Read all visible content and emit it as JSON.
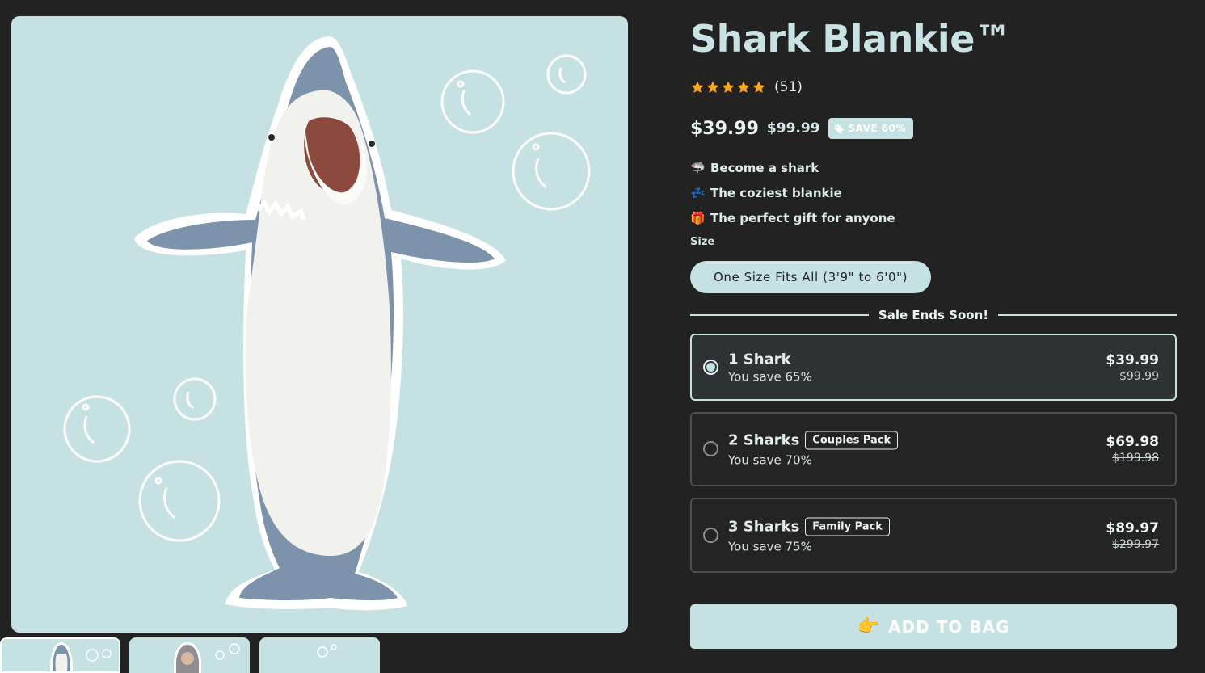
{
  "product": {
    "title": "Shark Blankie™",
    "review_count": "(51)",
    "rating_stars": 5,
    "price": "$39.99",
    "compare_price": "$99.99",
    "save_badge": "SAVE 60%"
  },
  "features": [
    {
      "icon": "shark-emoji-icon",
      "glyph": "🦈",
      "label": "Become a shark"
    },
    {
      "icon": "zzz-emoji-icon",
      "glyph": "💤",
      "label": "The coziest blankie"
    },
    {
      "icon": "gift-emoji-icon",
      "glyph": "🎁",
      "label": "The perfect gift for anyone"
    }
  ],
  "size": {
    "label": "Size",
    "selected": "One Size Fits All (3'9\" to 6'0\")"
  },
  "sale_banner": "Sale Ends Soon!",
  "bundles": [
    {
      "name": "1 Shark",
      "tag": "",
      "save": "You save 65%",
      "price": "$39.99",
      "was": "$99.99",
      "selected": true
    },
    {
      "name": "2 Sharks",
      "tag": "Couples Pack",
      "save": "You save 70%",
      "price": "$69.98",
      "was": "$199.98",
      "selected": false
    },
    {
      "name": "3 Sharks",
      "tag": "Family Pack",
      "save": "You save 75%",
      "price": "$89.97",
      "was": "$299.97",
      "selected": false
    }
  ],
  "cta": {
    "label": "ADD TO BAG",
    "icon": "pointing-hand-icon",
    "glyph": "👉"
  },
  "colors": {
    "background": "#222222",
    "accent": "#c5e1e2",
    "star": "#f5a623"
  }
}
